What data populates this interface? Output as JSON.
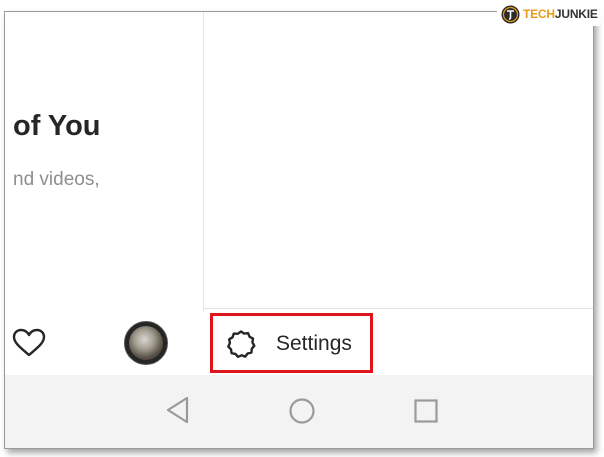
{
  "content": {
    "title": "of You",
    "subtitle": "nd videos,"
  },
  "bottom_nav": {
    "activity_icon": "heart-icon",
    "profile_icon": "avatar"
  },
  "menu": {
    "settings_label": "Settings",
    "settings_icon": "gear-icon",
    "highlight_color": "#e0141b"
  },
  "system_nav": {
    "back_icon": "back-triangle-icon",
    "home_icon": "home-circle-icon",
    "recents_icon": "recents-square-icon"
  },
  "watermark": {
    "brand_part1": "TECH",
    "brand_part2": "JUNKIE",
    "brand_color": "#e89b1a"
  }
}
